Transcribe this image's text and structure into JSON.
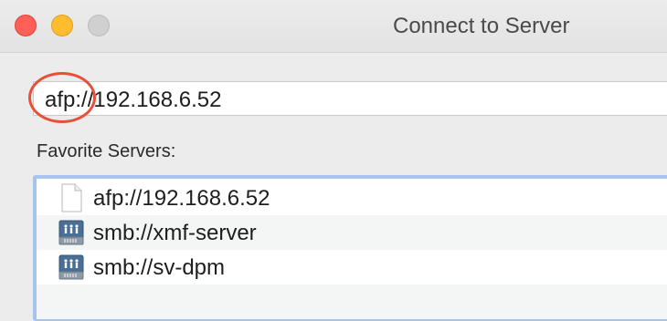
{
  "window": {
    "title": "Connect to Server",
    "traffic_lights": [
      "close",
      "minimize",
      "zoom"
    ]
  },
  "address": {
    "value": "afp://192.168.6.52",
    "highlight_color": "#e8503a"
  },
  "favorites": {
    "label": "Favorite Servers:",
    "items": [
      {
        "label": "afp://192.168.6.52",
        "icon": "document-icon"
      },
      {
        "label": "smb://xmf-server",
        "icon": "network-server-icon"
      },
      {
        "label": "smb://sv-dpm",
        "icon": "network-server-icon"
      }
    ]
  },
  "colors": {
    "focus_ring": "#a7c3f0",
    "close": "#fe5f57",
    "minimize": "#febc2e",
    "zoom": "#d0d0d0"
  }
}
